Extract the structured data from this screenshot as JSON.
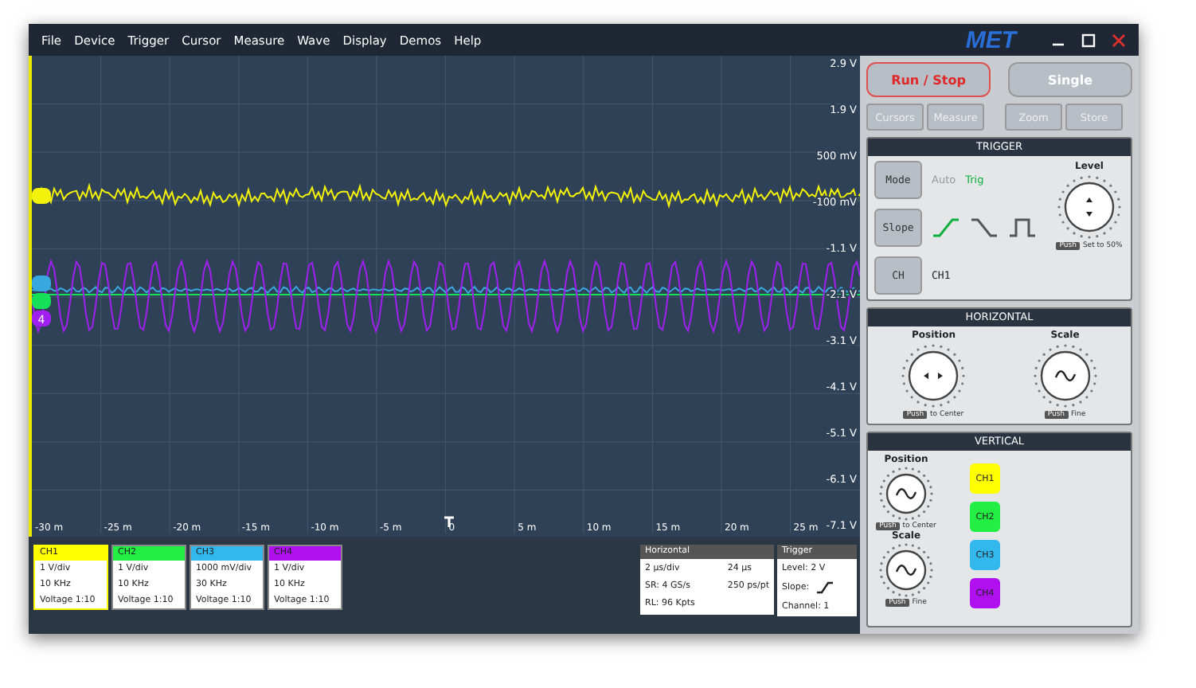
{
  "menu": [
    "File",
    "Device",
    "Trigger",
    "Cursor",
    "Measure",
    "Wave",
    "Display",
    "Demos",
    "Help"
  ],
  "logo": "MET",
  "plot": {
    "y_labels": [
      "2.9 V",
      "1.9 V",
      "500 mV",
      "-100 mV",
      "-1.1 V",
      "-2.1 V",
      "-3.1 V",
      "-4.1 V",
      "-5.1 V",
      "-6.1 V",
      "-7.1 V"
    ],
    "x_labels": [
      "-30 m",
      "-25 m",
      "-20 m",
      "-15 m",
      "-10 m",
      "-5 m",
      "0",
      "5 m",
      "10 m",
      "15 m",
      "20 m",
      "25 m"
    ],
    "traces": [
      {
        "kind": "noise",
        "color": "#f2f20a"
      },
      {
        "kind": "flat",
        "color": "#16e05a"
      },
      {
        "kind": "ripple",
        "color": "#3aa8e0"
      },
      {
        "kind": "sine",
        "color": "#a020f0",
        "label": "4"
      }
    ]
  },
  "run_stop": "Run / Stop",
  "single": "Single",
  "tools": [
    "Cursors",
    "Measure",
    "Zoom",
    "Store"
  ],
  "trigger": {
    "title": "TRIGGER",
    "mode_button": "Mode",
    "modes": [
      {
        "label": "Auto",
        "selected": false
      },
      {
        "label": "Trig",
        "selected": true
      }
    ],
    "slope_button": "Slope",
    "slopes": [
      {
        "kind": "rising",
        "selected": true
      },
      {
        "kind": "falling",
        "selected": false
      },
      {
        "kind": "pulse",
        "selected": false
      }
    ],
    "ch_button": "CH",
    "channel": "CH1",
    "knob": {
      "label": "Level",
      "kind": "updown",
      "push": "Push",
      "hint": "Set to 50%"
    }
  },
  "horizontal": {
    "title": "HORIZONTAL",
    "knobs": [
      {
        "label": "Position",
        "kind": "arrows",
        "push": "Push",
        "hint": "to Center"
      },
      {
        "label": "Scale",
        "kind": "wave",
        "push": "Push",
        "hint": "Fine"
      }
    ]
  },
  "vertical": {
    "title": "VERTICAL",
    "knobs": [
      {
        "label": "Position",
        "kind": "wave",
        "push": "Push",
        "hint": "to Center"
      },
      {
        "label": "Scale",
        "kind": "wave",
        "push": "Push",
        "hint": "Fine"
      }
    ],
    "channels": [
      {
        "label": "CH1",
        "color": "#ffff00"
      },
      {
        "label": "CH2",
        "color": "#22ee44"
      },
      {
        "label": "CH3",
        "color": "#33b8ee"
      },
      {
        "label": "CH4",
        "color": "#b010f0"
      }
    ]
  },
  "channel_cards": [
    {
      "name": "CH1",
      "color": "#ffff00",
      "selected": true,
      "lines": [
        "1 V/div",
        "10 KHz",
        "Voltage 1:10"
      ]
    },
    {
      "name": "CH2",
      "color": "#22ee44",
      "selected": false,
      "lines": [
        "1 V/div",
        "10 KHz",
        "Voltage 1:10"
      ]
    },
    {
      "name": "CH3",
      "color": "#33b8ee",
      "selected": false,
      "lines": [
        "1000 mV/div",
        "30 KHz",
        "Voltage 1:10"
      ]
    },
    {
      "name": "CH4",
      "color": "#b010f0",
      "selected": false,
      "lines": [
        "1 V/div",
        "10 KHz",
        "Voltage 1:10"
      ]
    }
  ],
  "horizontal_info": {
    "title": "Horizontal",
    "cells": [
      "2 µs/div",
      "24 µs",
      "SR: 4 GS/s",
      "250 ps/pt",
      "RL: 96 Kpts"
    ]
  },
  "trigger_info": {
    "title": "Trigger",
    "level": "Level: 2 V",
    "slope": "Slope:",
    "channel": "Channel: 1"
  }
}
